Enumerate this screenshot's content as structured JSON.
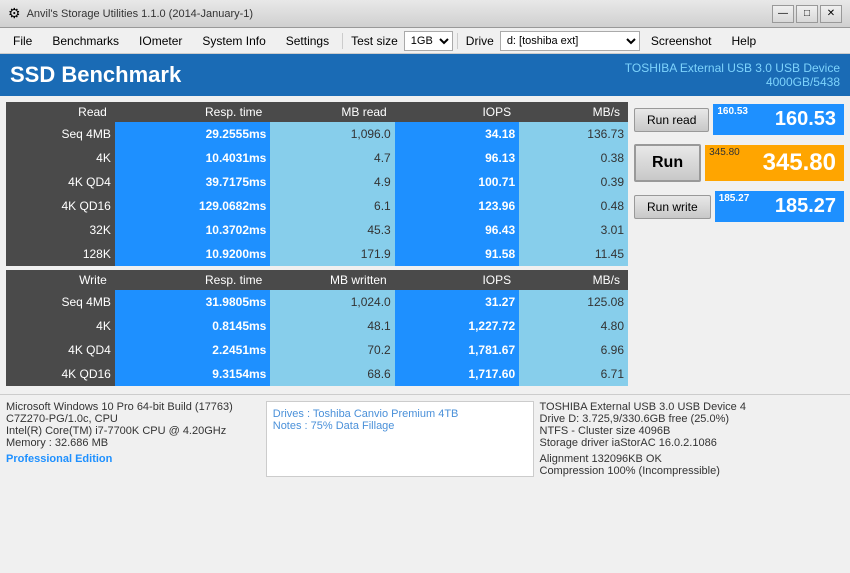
{
  "titleBar": {
    "title": "Anvil's Storage Utilities 1.1.0 (2014-January-1)",
    "minimize": "—",
    "maximize": "□",
    "close": "✕"
  },
  "menuBar": {
    "items": [
      "File",
      "Benchmarks",
      "IOmeter",
      "System Info",
      "Settings"
    ],
    "testSizeLabel": "Test size",
    "testSizeValue": "1GB",
    "driveLabel": "Drive",
    "driveValue": "d: [toshiba ext]",
    "screenshot": "Screenshot",
    "help": "Help"
  },
  "header": {
    "title": "SSD Benchmark",
    "deviceLine1": "TOSHIBA External USB 3.0 USB Device",
    "deviceLine2": "4000GB/5438"
  },
  "readTable": {
    "headers": [
      "Read",
      "Resp. time",
      "MB read",
      "IOPS",
      "MB/s"
    ],
    "rows": [
      {
        "label": "Seq 4MB",
        "respTime": "29.2555ms",
        "mb": "1,096.0",
        "iops": "34.18",
        "mbs": "136.73"
      },
      {
        "label": "4K",
        "respTime": "10.4031ms",
        "mb": "4.7",
        "iops": "96.13",
        "mbs": "0.38"
      },
      {
        "label": "4K QD4",
        "respTime": "39.7175ms",
        "mb": "4.9",
        "iops": "100.71",
        "mbs": "0.39"
      },
      {
        "label": "4K QD16",
        "respTime": "129.0682ms",
        "mb": "6.1",
        "iops": "123.96",
        "mbs": "0.48"
      },
      {
        "label": "32K",
        "respTime": "10.3702ms",
        "mb": "45.3",
        "iops": "96.43",
        "mbs": "3.01"
      },
      {
        "label": "128K",
        "respTime": "10.9200ms",
        "mb": "171.9",
        "iops": "91.58",
        "mbs": "11.45"
      }
    ]
  },
  "writeTable": {
    "headers": [
      "Write",
      "Resp. time",
      "MB written",
      "IOPS",
      "MB/s"
    ],
    "rows": [
      {
        "label": "Seq 4MB",
        "respTime": "31.9805ms",
        "mb": "1,024.0",
        "iops": "31.27",
        "mbs": "125.08"
      },
      {
        "label": "4K",
        "respTime": "0.8145ms",
        "mb": "48.1",
        "iops": "1,227.72",
        "mbs": "4.80"
      },
      {
        "label": "4K QD4",
        "respTime": "2.2451ms",
        "mb": "70.2",
        "iops": "1,781.67",
        "mbs": "6.96"
      },
      {
        "label": "4K QD16",
        "respTime": "9.3154ms",
        "mb": "68.6",
        "iops": "1,717.60",
        "mbs": "6.71"
      }
    ]
  },
  "scores": {
    "readLabel": "Run read",
    "readScore": "160.53",
    "readSmall": "160.53",
    "runLabel": "Run",
    "totalScore": "345.80",
    "totalSmall": "345.80",
    "writeLabel": "Run write",
    "writeScore": "185.27",
    "writeSmall": "185.27"
  },
  "bottomLeft": {
    "line1": "Microsoft Windows 10 Pro 64-bit Build (17763)",
    "line2": "C7Z270-PG/1.0c, CPU",
    "line3": "Intel(R) Core(TM) i7-7700K CPU @ 4.20GHz",
    "line4": "Memory : 32.686 MB",
    "proEdition": "Professional Edition"
  },
  "bottomNotes": {
    "drives": "Drives : Toshiba Canvio Premium 4TB",
    "notes": "Notes : 75% Data Fillage"
  },
  "bottomRight": {
    "line1": "TOSHIBA External USB 3.0 USB Device 4",
    "line2": "Drive D: 3.725,9/330.6GB free (25.0%)",
    "line3": "NTFS - Cluster size 4096B",
    "line4": "Storage driver  iaStorAC 16.0.2.1086",
    "line5": "",
    "line6": "Alignment 132096KB OK",
    "line7": "Compression 100% (Incompressible)"
  }
}
